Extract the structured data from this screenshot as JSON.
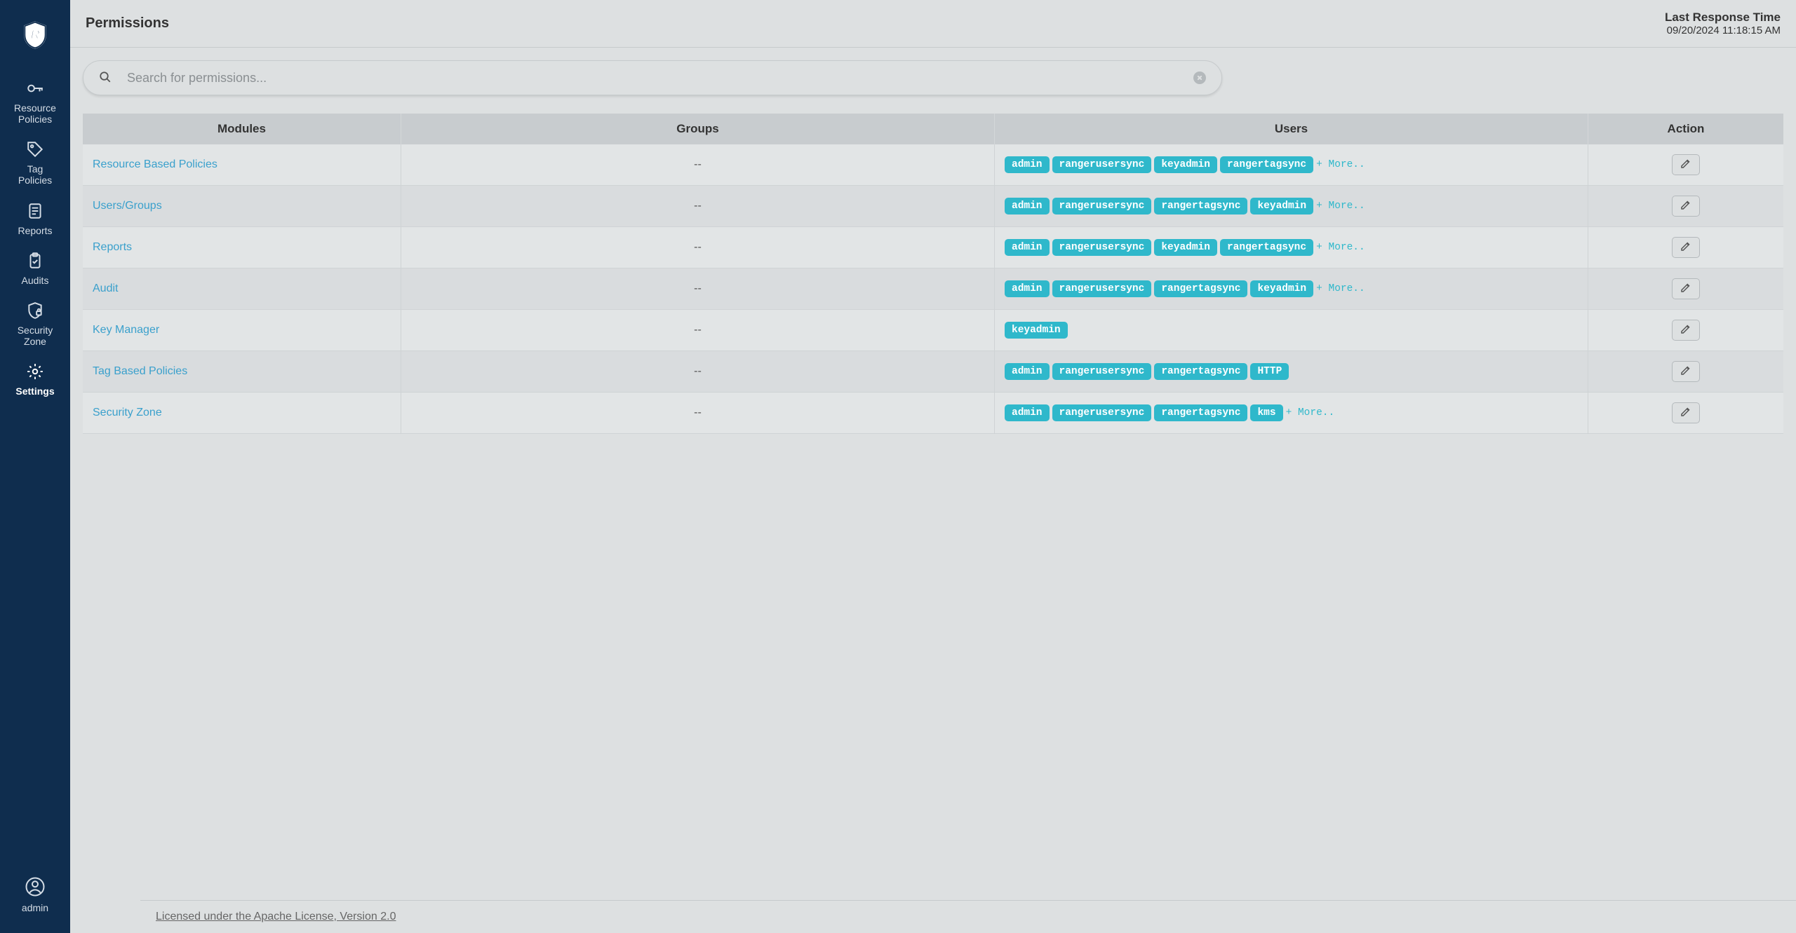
{
  "header": {
    "title": "Permissions",
    "last_response_label": "Last Response Time",
    "last_response_time": "09/20/2024 11:18:15 AM"
  },
  "search": {
    "placeholder": "Search for permissions..."
  },
  "sidebar": {
    "items": [
      {
        "label": "Resource\nPolicies",
        "icon": "key-icon"
      },
      {
        "label": "Tag\nPolicies",
        "icon": "tag-icon"
      },
      {
        "label": "Reports",
        "icon": "report-icon"
      },
      {
        "label": "Audits",
        "icon": "clipboard-icon"
      },
      {
        "label": "Security\nZone",
        "icon": "shield-lock-icon"
      },
      {
        "label": "Settings",
        "icon": "gear-icon"
      }
    ],
    "active_index": 5,
    "user": "admin"
  },
  "table": {
    "columns": [
      "Modules",
      "Groups",
      "Users",
      "Action"
    ],
    "rows": [
      {
        "module": "Resource Based Policies",
        "groups": "--",
        "users": [
          "admin",
          "rangerusersync",
          "keyadmin",
          "rangertagsync"
        ],
        "more": "+ More.."
      },
      {
        "module": "Users/Groups",
        "groups": "--",
        "users": [
          "admin",
          "rangerusersync",
          "rangertagsync",
          "keyadmin"
        ],
        "more": "+ More.."
      },
      {
        "module": "Reports",
        "groups": "--",
        "users": [
          "admin",
          "rangerusersync",
          "keyadmin",
          "rangertagsync"
        ],
        "more": "+ More.."
      },
      {
        "module": "Audit",
        "groups": "--",
        "users": [
          "admin",
          "rangerusersync",
          "rangertagsync",
          "keyadmin"
        ],
        "more": "+ More.."
      },
      {
        "module": "Key Manager",
        "groups": "--",
        "users": [
          "keyadmin"
        ],
        "more": null
      },
      {
        "module": "Tag Based Policies",
        "groups": "--",
        "users": [
          "admin",
          "rangerusersync",
          "rangertagsync",
          "HTTP"
        ],
        "more": null
      },
      {
        "module": "Security Zone",
        "groups": "--",
        "users": [
          "admin",
          "rangerusersync",
          "rangertagsync",
          "kms"
        ],
        "more": "+ More.."
      }
    ]
  },
  "footer": {
    "license": "Licensed under the Apache License, Version 2.0"
  },
  "icons": {
    "key-icon": "key",
    "tag-icon": "tag",
    "report-icon": "report",
    "clipboard-icon": "clipboard",
    "shield-lock-icon": "shield-lock",
    "gear-icon": "gear"
  }
}
